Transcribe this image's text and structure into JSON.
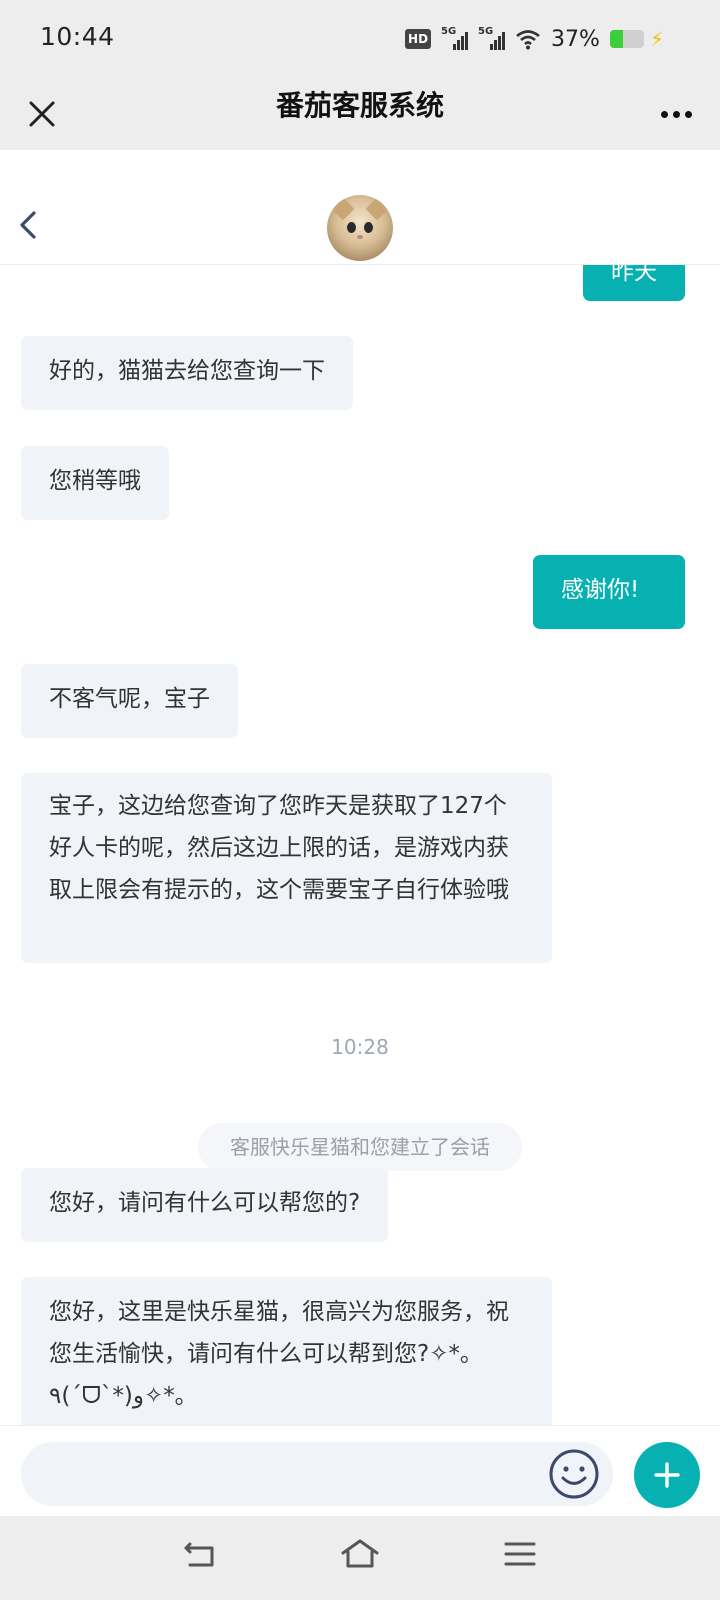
{
  "status_bar": {
    "time": "10:44",
    "hd_label": "HD",
    "net1": "5G",
    "net2": "5G",
    "battery_percent": "37%",
    "battery_level": 0.37
  },
  "header": {
    "title": "番茄客服系统",
    "close_icon": "close-icon",
    "more_icon": "more-horizontal-icon"
  },
  "chat_header": {
    "back_icon": "chevron-left-icon",
    "avatar": "cat-avatar"
  },
  "messages": [
    {
      "side": "right",
      "text": "昨天"
    },
    {
      "side": "left",
      "text": "好的，猫猫去给您查询一下"
    },
    {
      "side": "left",
      "text": "您稍等哦"
    },
    {
      "side": "right",
      "text": "感谢你!"
    },
    {
      "side": "left",
      "text": "不客气呢，宝子"
    },
    {
      "side": "left",
      "text": "宝子，这边给您查询了您昨天是获取了127个好人卡的呢，然后这边上限的话，是游戏内获取上限会有提示的，这个需要宝子自行体验哦"
    },
    {
      "side": "left",
      "text": "您好，请问有什么可以帮您的?"
    },
    {
      "side": "left",
      "text": "您好，这里是快乐星猫，很高兴为您服务，祝您生活愉快，请问有什么可以帮到您?✧*｡٩(ˊᗜˋ*)و✧*｡"
    }
  ],
  "timestamp": "10:28",
  "system_notice": "客服快乐星猫和您建立了会话",
  "input": {
    "placeholder": "",
    "emoji_icon": "smiley-icon",
    "plus_icon": "plus-icon"
  },
  "nav": {
    "back_icon": "nav-back-icon",
    "home_icon": "nav-home-icon",
    "menu_icon": "nav-menu-icon"
  },
  "colors": {
    "accent": "#08b1b1",
    "bubble_left": "#f0f3f7",
    "bar_bg": "#ededed"
  }
}
